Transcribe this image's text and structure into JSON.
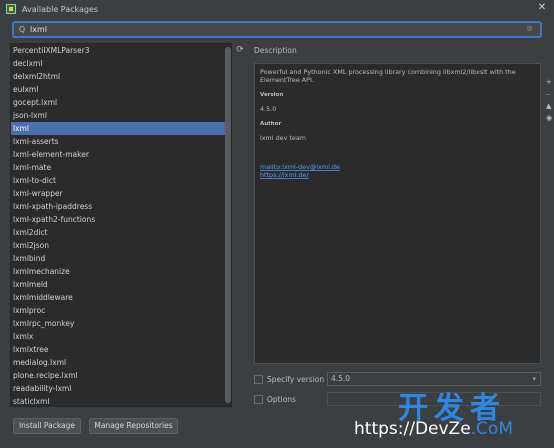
{
  "window": {
    "title": "Available Packages",
    "close_glyph": "✕",
    "icon": "pycharm-app-icon"
  },
  "search": {
    "value": "lxml",
    "icon_glyph": "Q",
    "clear_glyph": "⊗"
  },
  "packages": [
    "PercentiIXMLParser3",
    "declxml",
    "delxml2html",
    "eulxml",
    "gocept.lxml",
    "json-lxml",
    "lxml",
    "lxml-asserts",
    "lxml-element-maker",
    "lxml-mate",
    "lxml-to-dict",
    "lxml-wrapper",
    "lxml-xpath-ipaddress",
    "lxml-xpath2-functions",
    "lxml2dict",
    "lxml2json",
    "lxmlbind",
    "lxmlmechanize",
    "lxmlmeld",
    "lxmlmiddleware",
    "lxmlproc",
    "lxmlrpc_monkey",
    "lxmlx",
    "lxmlxtree",
    "medialog.lxml",
    "plone.recipe.lxml",
    "readability-lxml",
    "staticlxml"
  ],
  "selected_package": "lxml",
  "refresh_glyph": "⟳",
  "description": {
    "label": "Description",
    "text": "Powerful and Pythonic XML processing library combining libxml2/libxslt with the ElementTree API.",
    "version_title": "Version",
    "version_value": "4.5.0",
    "author_title": "Author",
    "author_value": "lxml dev team",
    "link_mail": "mailto:lxml-dev@lxml.de",
    "link_site": "https://lxml.de/"
  },
  "options": {
    "specify_version_label": "Specify version",
    "specify_version_value": "4.5.0",
    "options_label": "Options",
    "dropdown_glyph": "▾"
  },
  "buttons": {
    "install": "Install Package",
    "manage": "Manage Repositories"
  },
  "side_glyphs": [
    "+",
    "–",
    "▲",
    "◉"
  ],
  "watermark": {
    "chinese": "开发者",
    "url_head": "https://",
    "url_mid": "DevZe",
    "url_tail": ".CoM"
  },
  "colors": {
    "background": "#3c3f41",
    "selection": "#4b6eaf",
    "accent_focus": "#3b79c8",
    "link": "#5c9cf2"
  }
}
